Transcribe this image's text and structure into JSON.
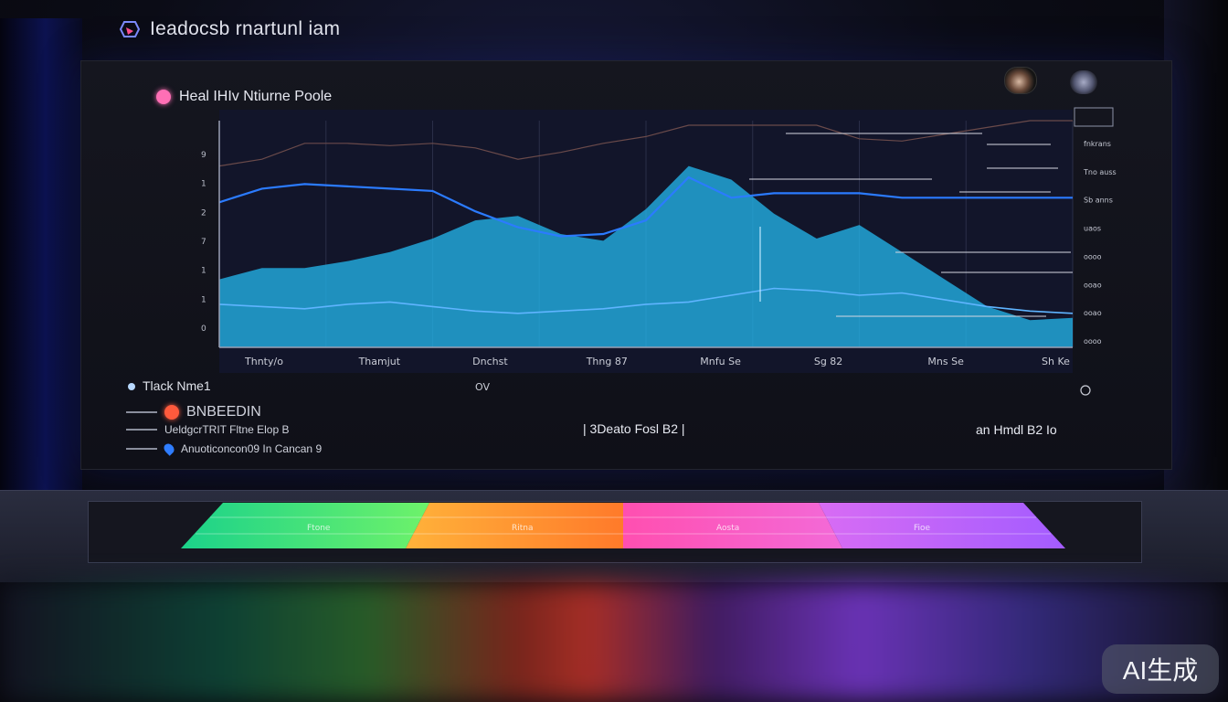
{
  "header": {
    "app_title": "Ieadocsb rnartunl iam"
  },
  "panel": {
    "title": "Heal IHIv Ntiurne Poole"
  },
  "chart_data": {
    "type": "area",
    "x": [
      0,
      1,
      2,
      3,
      4,
      5,
      6,
      7,
      8,
      9,
      10,
      11,
      12,
      13,
      14,
      15,
      16,
      17,
      18,
      19,
      20
    ],
    "x_tick_labels": [
      "Thnty/o",
      "Thamjut",
      "Dnchst",
      "Thng 87",
      "Mnfu Se",
      "Sg 82",
      "Mns Se",
      "Sh Ke"
    ],
    "y_tick_labels": [
      "9",
      "1",
      "2",
      "7",
      "1",
      "1",
      "0"
    ],
    "right_labels": [
      "fnkrans",
      "Tno auss",
      "Sb anns",
      "uaos",
      "oooo",
      "ooao",
      "ooao",
      "oooo"
    ],
    "ylim": [
      0,
      10
    ],
    "grid": true,
    "series": [
      {
        "values": [
          3.0,
          3.5,
          3.5,
          3.8,
          4.2,
          4.8,
          5.6,
          5.8,
          5.0,
          4.7,
          6.1,
          8.0,
          7.4,
          5.9,
          4.8,
          5.4,
          4.2,
          3.0,
          1.8,
          1.2,
          1.3
        ]
      },
      {
        "values": [
          6.4,
          7.0,
          7.2,
          7.1,
          7.0,
          6.9,
          6.0,
          5.3,
          4.9,
          5.0,
          5.6,
          7.5,
          6.6,
          6.8,
          6.8,
          6.8,
          6.6,
          6.6,
          6.6,
          6.6,
          6.6
        ]
      },
      {
        "values": [
          1.9,
          1.8,
          1.7,
          1.9,
          2.0,
          1.8,
          1.6,
          1.5,
          1.6,
          1.7,
          1.9,
          2.0,
          2.3,
          2.6,
          2.5,
          2.3,
          2.4,
          2.1,
          1.8,
          1.6,
          1.5
        ]
      },
      {
        "values": [
          8.0,
          8.3,
          9.0,
          9.0,
          8.9,
          9.0,
          8.8,
          8.3,
          8.6,
          9.0,
          9.3,
          9.8,
          9.8,
          9.8,
          9.8,
          9.2,
          9.1,
          9.4,
          9.7,
          10.0,
          10.0
        ]
      }
    ],
    "colors": {
      "area": "#22b4e8",
      "line_blue": "#2b7bff",
      "line_light": "#5fb4ff",
      "line_dark": "#6a4a4a"
    }
  },
  "summary": {
    "track": "Tlack Nme1",
    "axis_unit": "OV"
  },
  "legend": {
    "entry_a": "BNBEEDIN",
    "entry_b": "UeldgcrTRIT Fltne Elop   B",
    "entry_c": "Anuoticoncon09 In Cancan 9"
  },
  "status": {
    "mid": "3Deato Fosl  B2",
    "right": "an Hmdl  B2  Io"
  },
  "tiles": {
    "labels": [
      "Ftone",
      "Ritna",
      "Aosta",
      "Fioe"
    ]
  },
  "watermark": "AI生成"
}
